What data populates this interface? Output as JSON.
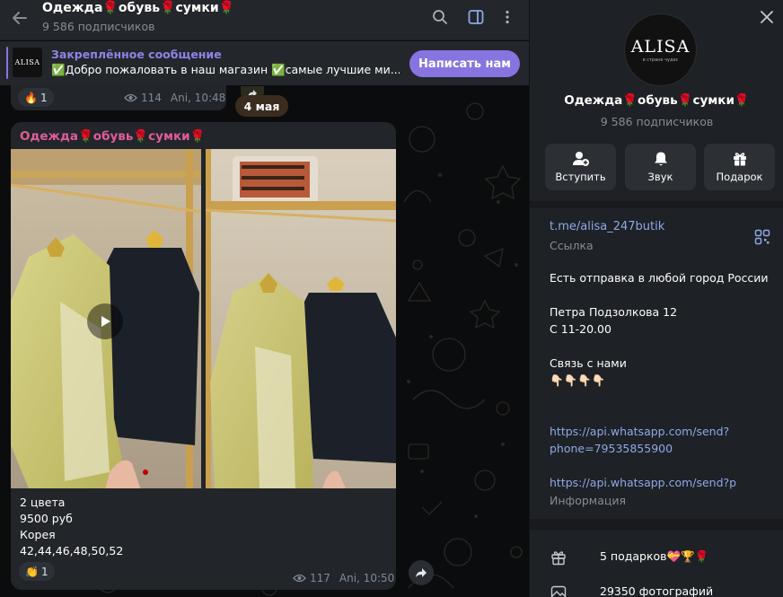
{
  "channel": {
    "title": "Одежда🌹обувь🌹сумки🌹",
    "subscribers": "9 586 подписчиков"
  },
  "pinned": {
    "title": "Закреплённое сообщение",
    "text": "✅Добро пожаловать в наш магазин ✅самые лучшие ми...",
    "thumb_text": "ALISA",
    "button": "Написать нам"
  },
  "prev_message": {
    "reaction_emoji": "🔥",
    "reaction_count": "1",
    "views": "114",
    "meta": "Ani, 10:48"
  },
  "date_separator": "4 мая",
  "message": {
    "author": "Одежда🌹обувь🌹сумки🌹",
    "caption_lines": [
      "2 цвета",
      "9500 руб",
      "Корея",
      "42,44,46,48,50,52"
    ],
    "reaction_emoji": "👏",
    "reaction_count": "1",
    "views": "117",
    "meta": "Ani, 10:50"
  },
  "profile": {
    "avatar_text": "ALISA",
    "avatar_tag": "в стране чудес",
    "title": "Одежда🌹обувь🌹сумки🌹",
    "subscribers": "9 586 подписчиков",
    "actions": [
      {
        "label": "Вступить",
        "icon": "add-user-icon"
      },
      {
        "label": "Звук",
        "icon": "bell-icon"
      },
      {
        "label": "Подарок",
        "icon": "gift-icon"
      }
    ],
    "link": "t.me/alisa_247butik",
    "link_caption": "Ссылка",
    "bio_text": "Есть отправка в любой город России\n\nПетра Подзолкова 12\nС 11-20.00\n\nСвязь с нами\n👇🏻👇🏻👇🏻👇🏻",
    "bio_link1": "https://api.whatsapp.com/send?\nphone=79535855900",
    "bio_link2": "https://api.whatsapp.com/send?p",
    "info_caption": "Информация",
    "gifts": "5 подарков💝🏆🌹",
    "photos": "29350 фотографий"
  },
  "colors": {
    "accent": "#8774e1",
    "link": "#8fa9e8",
    "author": "#e05d99",
    "panel_bg": "#1e2125",
    "bubble_bg": "#222529"
  }
}
